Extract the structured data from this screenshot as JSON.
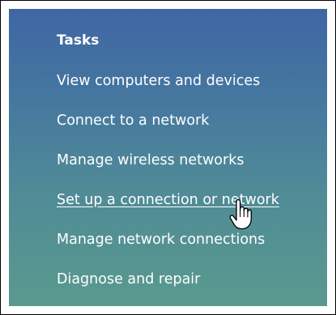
{
  "tasks": {
    "title": "Tasks",
    "items": [
      {
        "label": "View computers and devices"
      },
      {
        "label": "Connect to a network"
      },
      {
        "label": "Manage wireless networks"
      },
      {
        "label": "Set up a connection or network"
      },
      {
        "label": "Manage network connections"
      },
      {
        "label": "Diagnose and repair"
      }
    ]
  },
  "cursor": {
    "icon": "hand-pointer-icon"
  },
  "colors": {
    "panel_top": "#3f66a3",
    "panel_bottom": "#5a9a8e",
    "text": "#ffffff"
  }
}
